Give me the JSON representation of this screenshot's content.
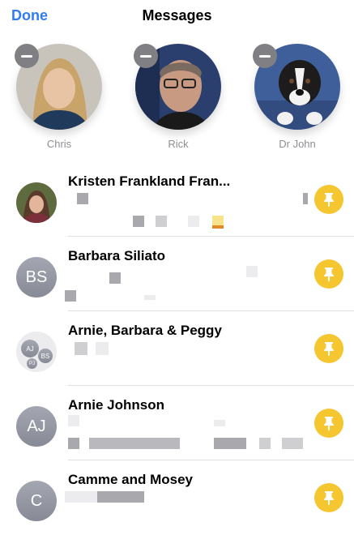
{
  "header": {
    "done_label": "Done",
    "title": "Messages"
  },
  "pinned": [
    {
      "name": "Chris"
    },
    {
      "name": "Rick"
    },
    {
      "name": "Dr John"
    }
  ],
  "conversations": [
    {
      "name": "Kristen Frankland Fran..."
    },
    {
      "name": "Barbara Siliato",
      "initials": "BS"
    },
    {
      "name": "Arnie, Barbara & Peggy",
      "group_initials": [
        "AJ",
        "BS",
        "PJ"
      ]
    },
    {
      "name": "Arnie Johnson",
      "initials": "AJ"
    },
    {
      "name": "Camme and Mosey",
      "initials": "C"
    }
  ],
  "colors": {
    "accent": "#2f7cf6",
    "pin": "#f5c630",
    "remove": "#808084"
  },
  "icons": [
    "minus-icon",
    "pin-icon"
  ]
}
